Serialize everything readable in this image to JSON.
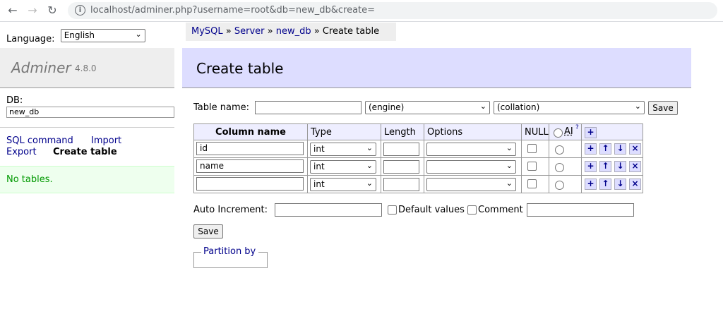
{
  "browser": {
    "url": "localhost/adminer.php?username=root&db=new_db&create=",
    "back_glyph": "←",
    "forward_glyph": "→",
    "reload_glyph": "↻"
  },
  "menu": {
    "language_label": "Language:",
    "language_value": "English",
    "app_name": "Adminer",
    "version": "4.8.0",
    "db_label": "DB:",
    "db_value": "new_db",
    "links": {
      "sql_command": "SQL command",
      "import": "Import",
      "export": "Export",
      "create_table": "Create table"
    },
    "no_tables": "No tables."
  },
  "breadcrumb": {
    "mysql": "MySQL",
    "sep": " » ",
    "server": "Server",
    "db": "new_db",
    "current": "Create table"
  },
  "page": {
    "title": "Create table",
    "table_name_label": "Table name:",
    "table_name_value": "",
    "engine": "(engine)",
    "collation": "(collation)",
    "save": "Save"
  },
  "fields": {
    "headers": {
      "column_name": "Column name",
      "type": "Type",
      "length": "Length",
      "options": "Options",
      "null": "NULL",
      "ai": "AI",
      "ai_help": "?",
      "add": "+"
    },
    "rows": [
      {
        "name": "id",
        "type": "int",
        "length": "",
        "options": ""
      },
      {
        "name": "name",
        "type": "int",
        "length": "",
        "options": ""
      },
      {
        "name": "",
        "type": "int",
        "length": "",
        "options": ""
      }
    ],
    "actions": {
      "add": "+",
      "up": "↑",
      "down": "↓",
      "remove": "×"
    }
  },
  "footer": {
    "auto_increment_label": "Auto Increment:",
    "auto_increment_value": "",
    "default_values_label": "Default values",
    "comment_label": "Comment",
    "comment_value": "",
    "save": "Save",
    "partition_by": "Partition by"
  },
  "colors": {
    "heading_bg": "#ddf",
    "link": "#00008b",
    "success_bg": "#eeffee",
    "success_text": "#009900"
  }
}
